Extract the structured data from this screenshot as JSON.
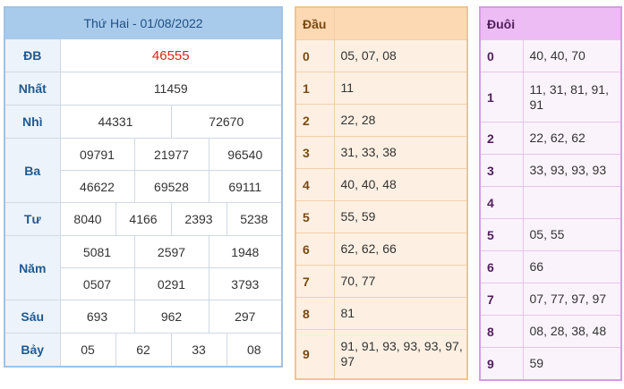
{
  "results": {
    "title": "Thứ Hai - 01/08/2022",
    "rows": [
      {
        "label": "ĐB",
        "values": [
          "46555"
        ]
      },
      {
        "label": "Nhất",
        "values": [
          "11459"
        ]
      },
      {
        "label": "Nhì",
        "values": [
          "44331",
          "72670"
        ]
      },
      {
        "label": "Ba",
        "values": [
          "09791",
          "21977",
          "96540",
          "46622",
          "69528",
          "69111"
        ]
      },
      {
        "label": "Tư",
        "values": [
          "8040",
          "4166",
          "2393",
          "5238"
        ]
      },
      {
        "label": "Năm",
        "values": [
          "5081",
          "2597",
          "1948",
          "0507",
          "0291",
          "3793"
        ]
      },
      {
        "label": "Sáu",
        "values": [
          "693",
          "962",
          "297"
        ]
      },
      {
        "label": "Bảy",
        "values": [
          "05",
          "62",
          "33",
          "08"
        ]
      }
    ],
    "colors": {
      "special": "#e0211e",
      "header": "#a9cbeb",
      "label": "#1d5a93"
    }
  },
  "dau": {
    "header": "Đầu",
    "rows": [
      {
        "key": "0",
        "value": "05, 07, 08"
      },
      {
        "key": "1",
        "value": "11"
      },
      {
        "key": "2",
        "value": "22, 28"
      },
      {
        "key": "3",
        "value": "31, 33, 38"
      },
      {
        "key": "4",
        "value": "40, 40, 48"
      },
      {
        "key": "5",
        "value": "55, 59"
      },
      {
        "key": "6",
        "value": "62, 62, 66"
      },
      {
        "key": "7",
        "value": "70, 77"
      },
      {
        "key": "8",
        "value": "81"
      },
      {
        "key": "9",
        "value": "91, 91, 93, 93, 93, 97, 97"
      }
    ],
    "colors": {
      "header": "#fcd9b3",
      "border": "#f7c28a"
    }
  },
  "duoi": {
    "header": "Đuôi",
    "rows": [
      {
        "key": "0",
        "value": "40, 40, 70"
      },
      {
        "key": "1",
        "value": "11, 31, 81, 91, 91"
      },
      {
        "key": "2",
        "value": "22, 62, 62"
      },
      {
        "key": "3",
        "value": "33, 93, 93, 93"
      },
      {
        "key": "4",
        "value": ""
      },
      {
        "key": "5",
        "value": "05, 55"
      },
      {
        "key": "6",
        "value": "66"
      },
      {
        "key": "7",
        "value": "07, 77, 97, 97"
      },
      {
        "key": "8",
        "value": "08, 28, 38, 48"
      },
      {
        "key": "9",
        "value": "59"
      }
    ],
    "colors": {
      "header": "#edbcf5",
      "border": "#d79be4"
    }
  }
}
